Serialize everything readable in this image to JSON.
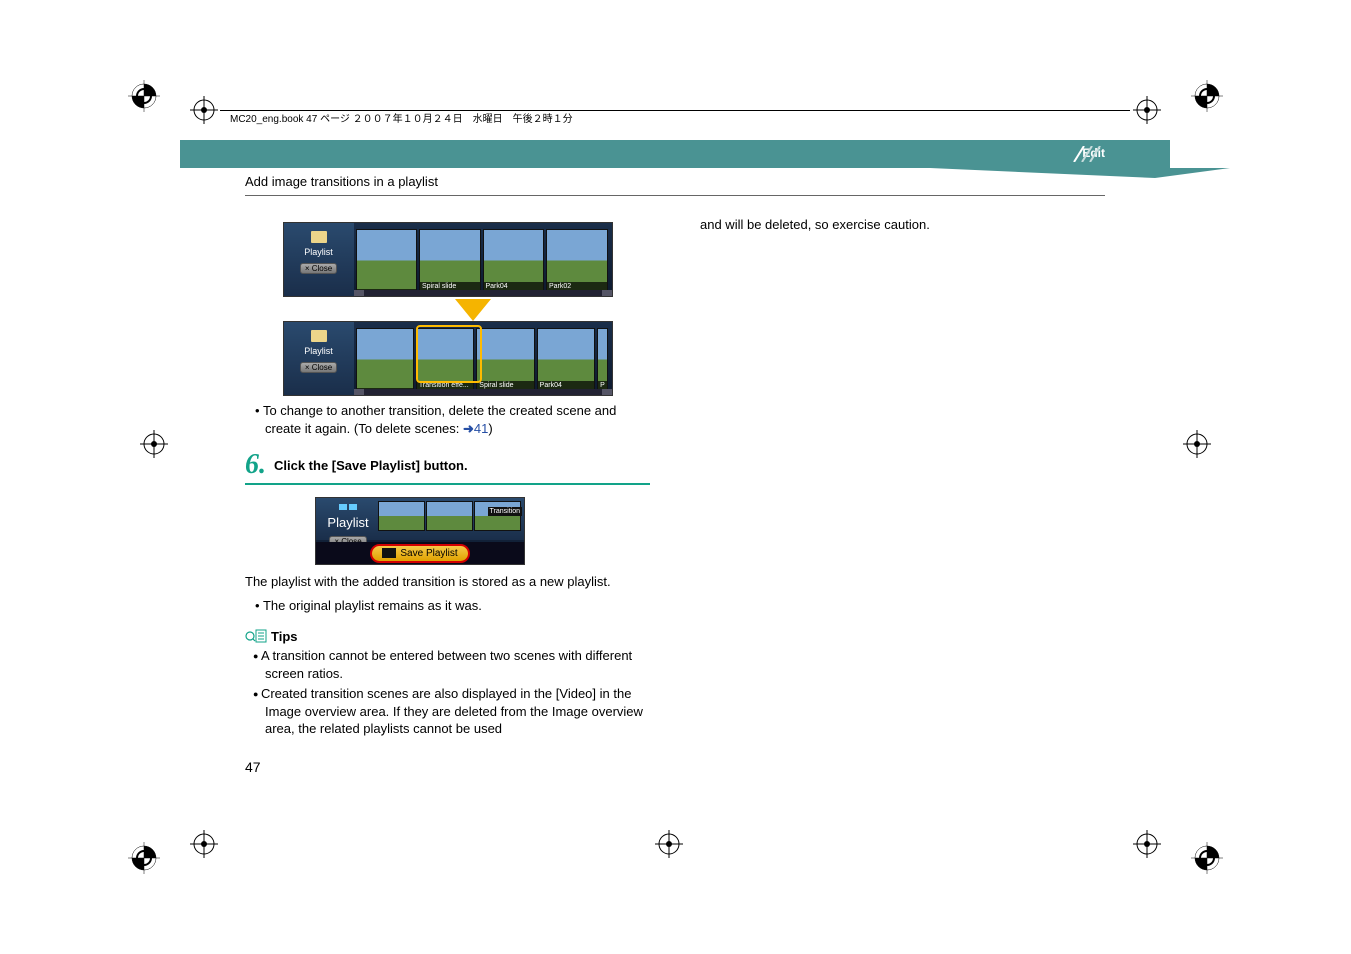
{
  "print_header": "MC20_eng.book  47 ページ  ２００７年１０月２４日　水曜日　午後２時１分",
  "header": {
    "edit": "Edit",
    "section": "Add image transitions in a playlist"
  },
  "screenshot1": {
    "playlist_label": "Playlist",
    "close_label": "× Close",
    "thumbs": [
      "",
      "Spiral slide",
      "Park04",
      "Park02"
    ]
  },
  "screenshot2": {
    "playlist_label": "Playlist",
    "close_label": "× Close",
    "thumbs": [
      "",
      "Transition effe...",
      "Spiral slide",
      "Park04",
      "P"
    ]
  },
  "note1": {
    "line1": "To change to another transition, delete the created scene and create it again. (To delete scenes: ",
    "arrow": "➜",
    "ref": "41",
    "tail": ")"
  },
  "step6": {
    "num": "6.",
    "text": "Click the [Save Playlist] button."
  },
  "screenshot3": {
    "playlist_label": "Playlist",
    "close_label": "× Close",
    "transition_label": "Transition",
    "save_label": "Save Playlist"
  },
  "after_save": {
    "para": "The playlist with the added transition is stored as a new playlist.",
    "bullet": "The original playlist remains as it was."
  },
  "tips": {
    "label": "Tips",
    "b1": "A transition cannot be entered between two scenes with different screen ratios.",
    "b2": "Created transition scenes are also displayed in the [Video] in the Image overview area. If they are deleted from the Image overview area, the related playlists cannot be used"
  },
  "col2": {
    "cont": "and will be deleted, so exercise caution."
  },
  "page_number": "47"
}
